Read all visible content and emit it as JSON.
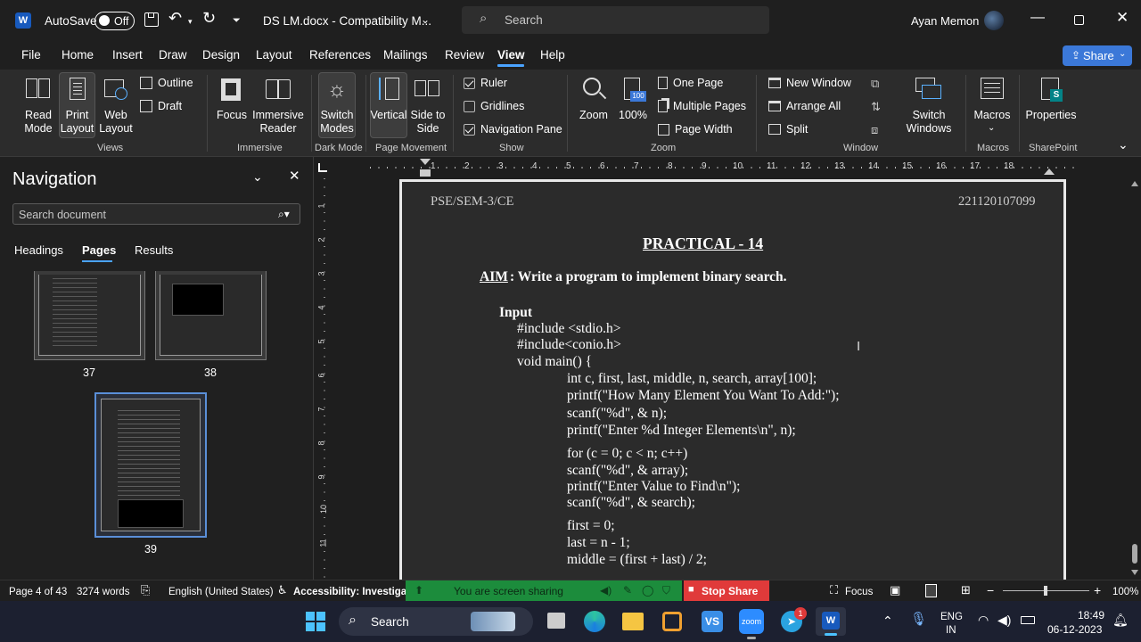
{
  "titlebar": {
    "autosave_label": "AutoSave",
    "autosave_state": "Off",
    "doc_title": "DS LM.docx  -  Compatibility M...",
    "search_placeholder": "Search",
    "user_name": "Ayan Memon"
  },
  "ribbon_tabs": [
    "File",
    "Home",
    "Insert",
    "Draw",
    "Design",
    "Layout",
    "References",
    "Mailings",
    "Review",
    "View",
    "Help"
  ],
  "active_tab": "View",
  "share_label": "Share",
  "ribbon": {
    "views": {
      "read_mode": "Read Mode",
      "print_layout": "Print Layout",
      "web_layout": "Web Layout",
      "outline": "Outline",
      "draft": "Draft",
      "group": "Views"
    },
    "immersive": {
      "focus": "Focus",
      "immersive_reader": "Immersive Reader",
      "group": "Immersive"
    },
    "dark_mode": {
      "switch_modes": "Switch Modes",
      "group": "Dark Mode"
    },
    "page_movement": {
      "vertical": "Vertical",
      "side_to_side": "Side to Side",
      "group": "Page Movement"
    },
    "show": {
      "ruler": "Ruler",
      "gridlines": "Gridlines",
      "navigation_pane": "Navigation Pane",
      "group": "Show"
    },
    "zoom": {
      "zoom": "Zoom",
      "zoom_100": "100%",
      "one_page": "One Page",
      "multiple_pages": "Multiple Pages",
      "page_width": "Page Width",
      "group": "Zoom",
      "icon_value": "100"
    },
    "window": {
      "new_window": "New Window",
      "arrange_all": "Arrange All",
      "split": "Split",
      "switch_windows": "Switch Windows",
      "group": "Window"
    },
    "macros": {
      "macros": "Macros",
      "group": "Macros"
    },
    "sharepoint": {
      "properties": "Properties",
      "group": "SharePoint"
    }
  },
  "navigation": {
    "title": "Navigation",
    "search_placeholder": "Search document",
    "tabs": [
      "Headings",
      "Pages",
      "Results"
    ],
    "active_tab": "Pages",
    "pages": [
      "37",
      "38",
      "39"
    ]
  },
  "document": {
    "header_left": "PSE/SEM-3/CE",
    "header_right": "221120107099",
    "title": "PRACTICAL - 14",
    "aim_label": "AIM",
    "aim_text": ": Write a program to implement binary search.",
    "input_label": "Input",
    "code": [
      "#include <stdio.h>",
      "#include<conio.h>",
      "void main() {",
      "int c, first, last, middle, n, search, array[100];",
      "printf(\"How Many Element You Want To Add:\");",
      "scanf(\"%d\", & n);",
      "printf(\"Enter %d Integer Elements\\n\", n);",
      "for (c = 0; c < n; c++)",
      "scanf(\"%d\", & array);",
      "printf(\"Enter Value to Find\\n\");",
      "scanf(\"%d\", & search);",
      "first = 0;",
      "last = n - 1;",
      "middle = (first + last) / 2;"
    ]
  },
  "status": {
    "page": "Page 4 of 43",
    "words": "3274 words",
    "language": "English (United States)",
    "accessibility": "Accessibility: Investigate",
    "sharing": "You are screen sharing",
    "stop_share": "Stop Share",
    "focus": "Focus",
    "zoom": "100%"
  },
  "taskbar": {
    "search": "Search",
    "lang_line1": "ENG",
    "lang_line2": "IN",
    "time": "18:49",
    "date": "06-12-2023",
    "zoom_app": "zoom",
    "badge": "1"
  },
  "colors": {
    "accent": "#4aa3ff",
    "share_btn": "#3b78d8",
    "green_bar": "#1c8c3c",
    "stop_red": "#e03a3a"
  }
}
